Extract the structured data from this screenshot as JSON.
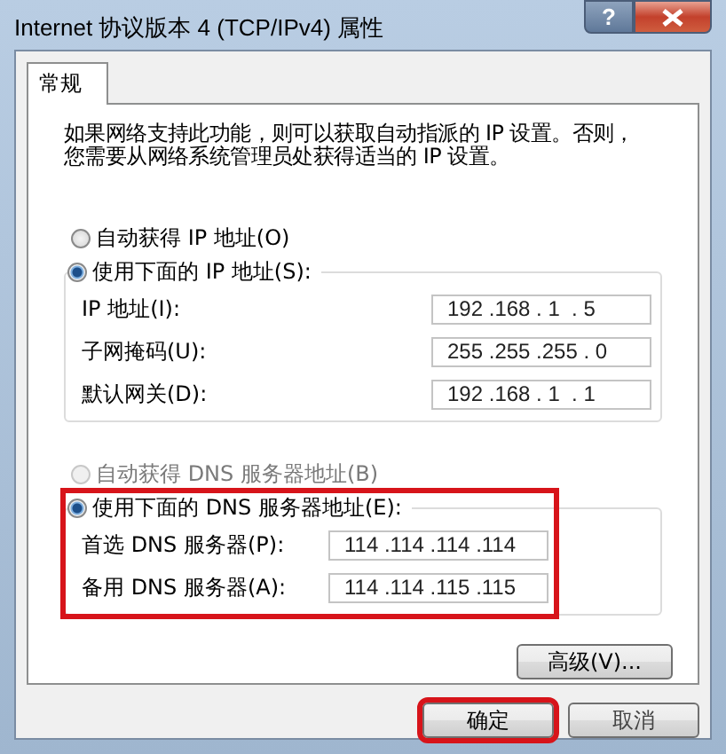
{
  "window": {
    "title": "Internet 协议版本 4 (TCP/IPv4) 属性",
    "help_button": "?"
  },
  "tabs": [
    {
      "label": "常规",
      "selected": true
    }
  ],
  "description_lines": [
    "如果网络支持此功能，则可以获取自动指派的 IP 设置。否则，",
    "您需要从网络系统管理员处获得适当的 IP 设置。"
  ],
  "ip_section": {
    "highlighted": false,
    "options": [
      {
        "label": "自动获得 IP 地址(O)",
        "selected": false,
        "disabled": false
      },
      {
        "label": "使用下面的 IP 地址(S):",
        "selected": true,
        "disabled": false
      }
    ],
    "fields": [
      {
        "label": "IP 地址(I):",
        "value": "192 .168 . 1  . 5"
      },
      {
        "label": "子网掩码(U):",
        "value": "255 .255 .255 . 0"
      },
      {
        "label": "默认网关(D):",
        "value": "192 .168 . 1  . 1"
      }
    ]
  },
  "dns_section": {
    "highlighted": true,
    "options": [
      {
        "label": "自动获得 DNS 服务器地址(B)",
        "selected": false,
        "disabled": true
      },
      {
        "label": "使用下面的 DNS 服务器地址(E):",
        "selected": true,
        "disabled": false
      }
    ],
    "fields": [
      {
        "label": "首选 DNS 服务器(P):",
        "value": "114 .114 .114 .114"
      },
      {
        "label": "备用 DNS 服务器(A):",
        "value": "114 .114 .115 .115"
      }
    ]
  },
  "advanced_button": "高级(V)...",
  "buttons": [
    {
      "label": "确定",
      "highlighted": true
    },
    {
      "label": "取消",
      "highlighted": false
    }
  ]
}
